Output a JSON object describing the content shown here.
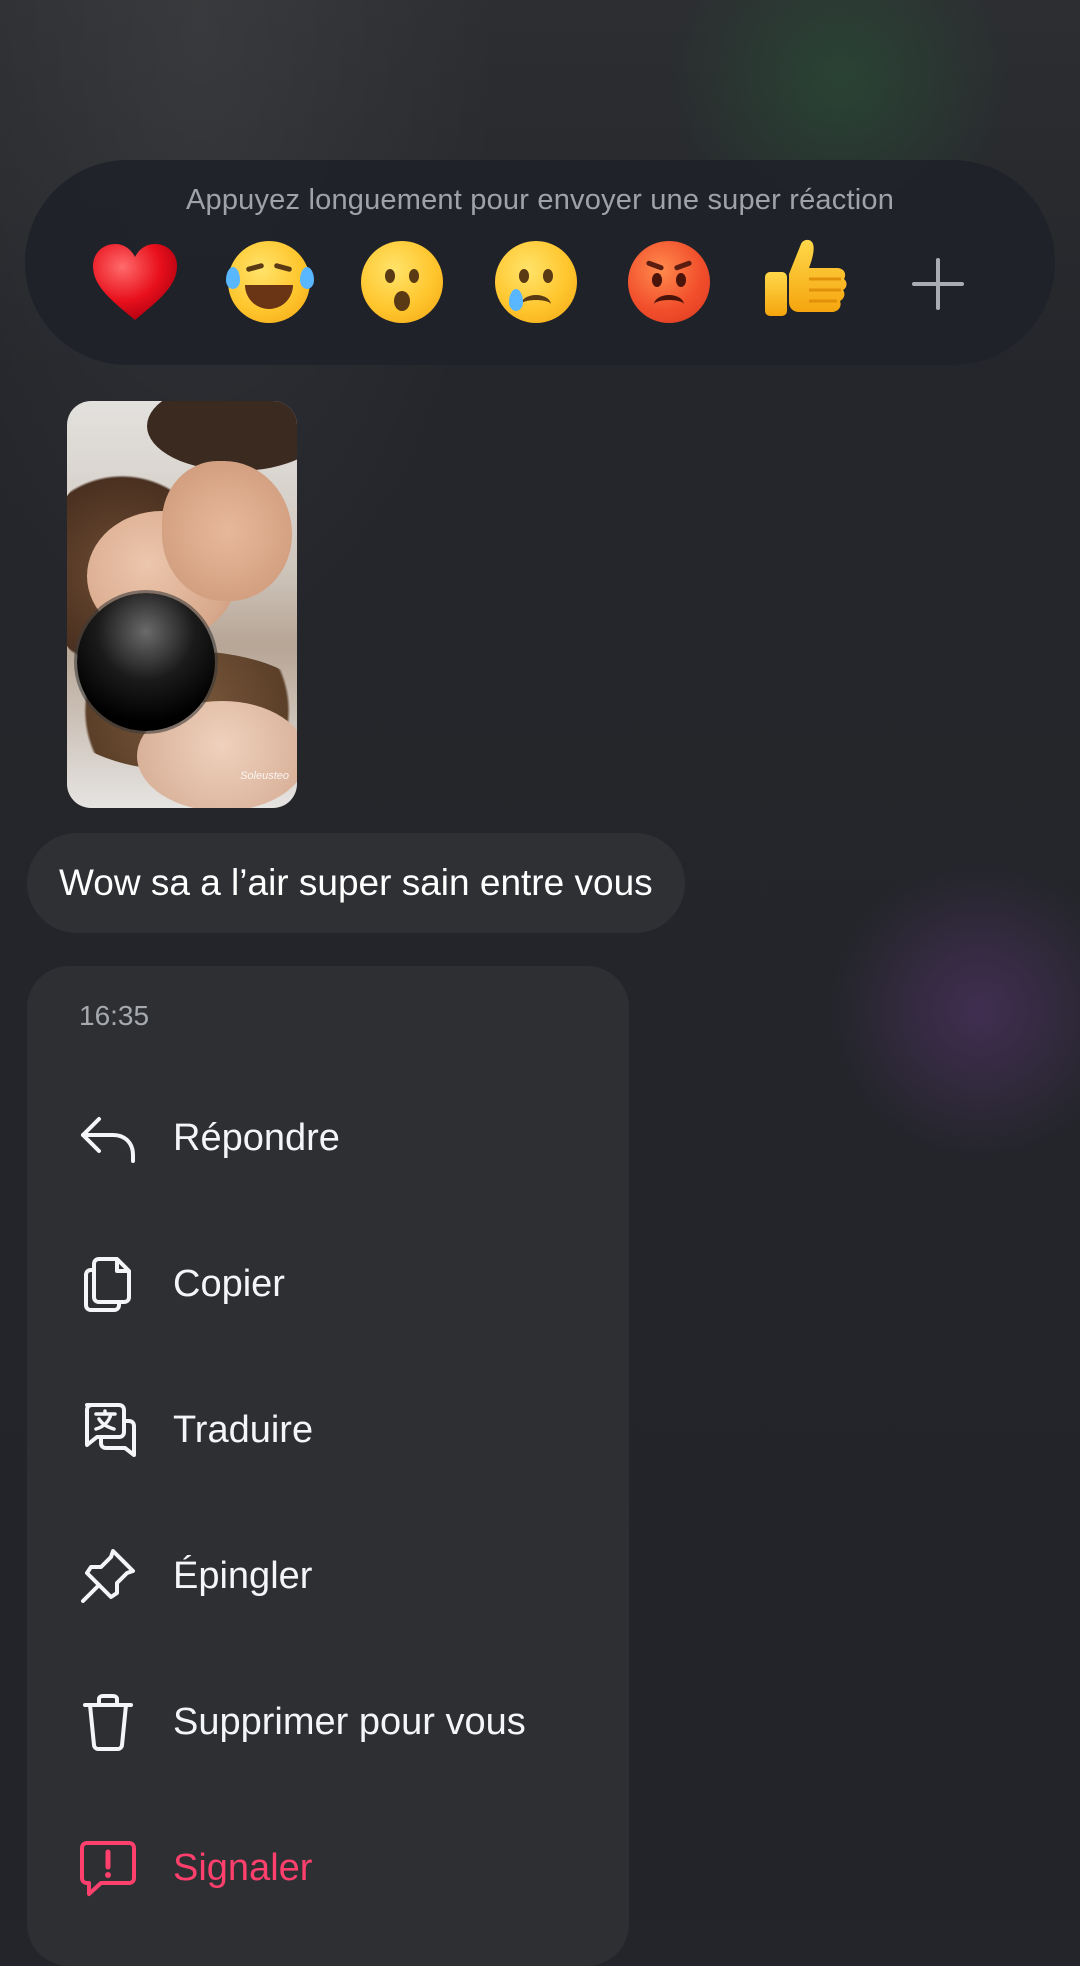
{
  "reactions": {
    "hint": "Appuyez longuement pour envoyer une super réaction",
    "items": [
      {
        "name": "heart",
        "glyph": "❤️"
      },
      {
        "name": "laugh"
      },
      {
        "name": "surprised"
      },
      {
        "name": "crying"
      },
      {
        "name": "angry"
      },
      {
        "name": "thumbs-up",
        "glyph": "👍"
      }
    ],
    "more_icon": "plus-icon"
  },
  "message": {
    "media_watermark": "Soleusteo",
    "text": "Wow sa a l’air super sain entre vous"
  },
  "menu": {
    "time": "16:35",
    "items": [
      {
        "label": "Répondre",
        "icon": "reply-icon"
      },
      {
        "label": "Copier",
        "icon": "copy-icon"
      },
      {
        "label": "Traduire",
        "icon": "translate-icon"
      },
      {
        "label": "Épingler",
        "icon": "pin-icon"
      },
      {
        "label": "Supprimer pour vous",
        "icon": "trash-icon"
      },
      {
        "label": "Signaler",
        "icon": "report-icon",
        "color": "#ff3f6c"
      }
    ]
  },
  "colors": {
    "background": "#23252a",
    "menu_background": "#2d2f33",
    "danger": "#ff3f6c"
  }
}
